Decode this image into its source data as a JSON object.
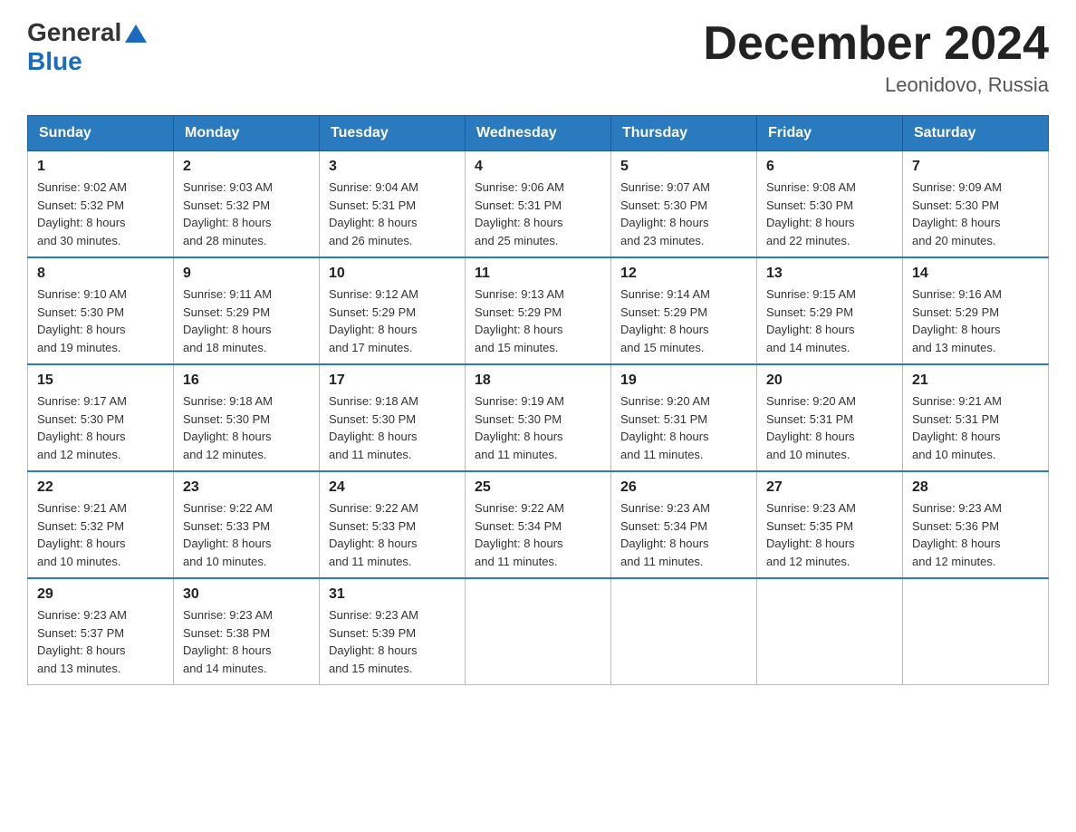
{
  "header": {
    "logo_general": "General",
    "logo_blue": "Blue",
    "month_title": "December 2024",
    "location": "Leonidovo, Russia"
  },
  "days_of_week": [
    "Sunday",
    "Monday",
    "Tuesday",
    "Wednesday",
    "Thursday",
    "Friday",
    "Saturday"
  ],
  "weeks": [
    [
      {
        "day": "1",
        "sunrise": "9:02 AM",
        "sunset": "5:32 PM",
        "daylight": "8 hours and 30 minutes."
      },
      {
        "day": "2",
        "sunrise": "9:03 AM",
        "sunset": "5:32 PM",
        "daylight": "8 hours and 28 minutes."
      },
      {
        "day": "3",
        "sunrise": "9:04 AM",
        "sunset": "5:31 PM",
        "daylight": "8 hours and 26 minutes."
      },
      {
        "day": "4",
        "sunrise": "9:06 AM",
        "sunset": "5:31 PM",
        "daylight": "8 hours and 25 minutes."
      },
      {
        "day": "5",
        "sunrise": "9:07 AM",
        "sunset": "5:30 PM",
        "daylight": "8 hours and 23 minutes."
      },
      {
        "day": "6",
        "sunrise": "9:08 AM",
        "sunset": "5:30 PM",
        "daylight": "8 hours and 22 minutes."
      },
      {
        "day": "7",
        "sunrise": "9:09 AM",
        "sunset": "5:30 PM",
        "daylight": "8 hours and 20 minutes."
      }
    ],
    [
      {
        "day": "8",
        "sunrise": "9:10 AM",
        "sunset": "5:30 PM",
        "daylight": "8 hours and 19 minutes."
      },
      {
        "day": "9",
        "sunrise": "9:11 AM",
        "sunset": "5:29 PM",
        "daylight": "8 hours and 18 minutes."
      },
      {
        "day": "10",
        "sunrise": "9:12 AM",
        "sunset": "5:29 PM",
        "daylight": "8 hours and 17 minutes."
      },
      {
        "day": "11",
        "sunrise": "9:13 AM",
        "sunset": "5:29 PM",
        "daylight": "8 hours and 15 minutes."
      },
      {
        "day": "12",
        "sunrise": "9:14 AM",
        "sunset": "5:29 PM",
        "daylight": "8 hours and 15 minutes."
      },
      {
        "day": "13",
        "sunrise": "9:15 AM",
        "sunset": "5:29 PM",
        "daylight": "8 hours and 14 minutes."
      },
      {
        "day": "14",
        "sunrise": "9:16 AM",
        "sunset": "5:29 PM",
        "daylight": "8 hours and 13 minutes."
      }
    ],
    [
      {
        "day": "15",
        "sunrise": "9:17 AM",
        "sunset": "5:30 PM",
        "daylight": "8 hours and 12 minutes."
      },
      {
        "day": "16",
        "sunrise": "9:18 AM",
        "sunset": "5:30 PM",
        "daylight": "8 hours and 12 minutes."
      },
      {
        "day": "17",
        "sunrise": "9:18 AM",
        "sunset": "5:30 PM",
        "daylight": "8 hours and 11 minutes."
      },
      {
        "day": "18",
        "sunrise": "9:19 AM",
        "sunset": "5:30 PM",
        "daylight": "8 hours and 11 minutes."
      },
      {
        "day": "19",
        "sunrise": "9:20 AM",
        "sunset": "5:31 PM",
        "daylight": "8 hours and 11 minutes."
      },
      {
        "day": "20",
        "sunrise": "9:20 AM",
        "sunset": "5:31 PM",
        "daylight": "8 hours and 10 minutes."
      },
      {
        "day": "21",
        "sunrise": "9:21 AM",
        "sunset": "5:31 PM",
        "daylight": "8 hours and 10 minutes."
      }
    ],
    [
      {
        "day": "22",
        "sunrise": "9:21 AM",
        "sunset": "5:32 PM",
        "daylight": "8 hours and 10 minutes."
      },
      {
        "day": "23",
        "sunrise": "9:22 AM",
        "sunset": "5:33 PM",
        "daylight": "8 hours and 10 minutes."
      },
      {
        "day": "24",
        "sunrise": "9:22 AM",
        "sunset": "5:33 PM",
        "daylight": "8 hours and 11 minutes."
      },
      {
        "day": "25",
        "sunrise": "9:22 AM",
        "sunset": "5:34 PM",
        "daylight": "8 hours and 11 minutes."
      },
      {
        "day": "26",
        "sunrise": "9:23 AM",
        "sunset": "5:34 PM",
        "daylight": "8 hours and 11 minutes."
      },
      {
        "day": "27",
        "sunrise": "9:23 AM",
        "sunset": "5:35 PM",
        "daylight": "8 hours and 12 minutes."
      },
      {
        "day": "28",
        "sunrise": "9:23 AM",
        "sunset": "5:36 PM",
        "daylight": "8 hours and 12 minutes."
      }
    ],
    [
      {
        "day": "29",
        "sunrise": "9:23 AM",
        "sunset": "5:37 PM",
        "daylight": "8 hours and 13 minutes."
      },
      {
        "day": "30",
        "sunrise": "9:23 AM",
        "sunset": "5:38 PM",
        "daylight": "8 hours and 14 minutes."
      },
      {
        "day": "31",
        "sunrise": "9:23 AM",
        "sunset": "5:39 PM",
        "daylight": "8 hours and 15 minutes."
      },
      null,
      null,
      null,
      null
    ]
  ],
  "labels": {
    "sunrise": "Sunrise:",
    "sunset": "Sunset:",
    "daylight": "Daylight:"
  }
}
